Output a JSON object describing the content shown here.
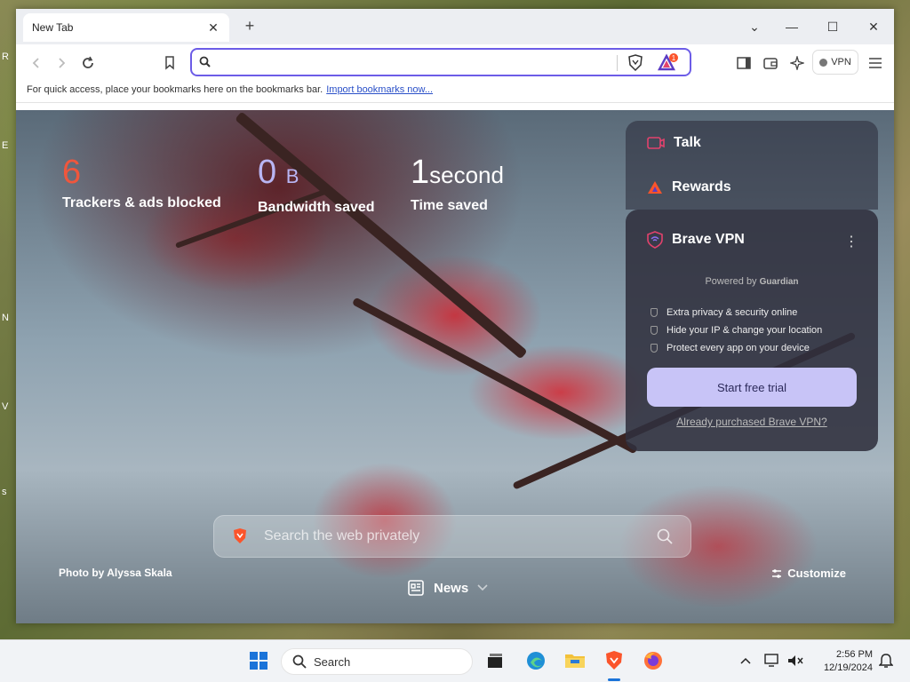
{
  "desktop": {
    "edge_letters": [
      "R",
      "E",
      "N",
      "V",
      "s"
    ]
  },
  "browser": {
    "tab": {
      "title": "New Tab",
      "close": "✕"
    },
    "new_tab": "+",
    "window": {
      "dropdown": "⌄",
      "minimize": "—",
      "maximize": "☐",
      "close": "✕"
    },
    "toolbar": {
      "vpn_label": "VPN",
      "rewards_badge": "1"
    },
    "bookmarks_bar": {
      "text": "For quick access, place your bookmarks here on the bookmarks bar.",
      "link": "Import bookmarks now..."
    }
  },
  "ntp": {
    "stats": [
      {
        "value": "6",
        "unit": "",
        "label": "Trackers & ads blocked",
        "color": "#f0563c"
      },
      {
        "value": "0",
        "unit": "B",
        "label": "Bandwidth saved",
        "color": "#b9b6f4"
      },
      {
        "value": "1",
        "unit": "second",
        "label": "Time saved",
        "color": "#ffffff"
      }
    ],
    "sidebar": {
      "talk": "Talk",
      "rewards": "Rewards"
    },
    "vpn_card": {
      "title": "Brave VPN",
      "powered_by": "Powered by",
      "partner": "Guardian",
      "features": [
        "Extra privacy & security online",
        "Hide your IP & change your location",
        "Protect every app on your device"
      ],
      "cta": "Start free trial",
      "already": "Already purchased Brave VPN?"
    },
    "search_placeholder": "Search the web privately",
    "photo_credit": "Photo by Alyssa Skala",
    "customize": "Customize",
    "news": "News"
  },
  "taskbar": {
    "search": "Search",
    "time": "2:56 PM",
    "date": "12/19/2024"
  },
  "colors": {
    "accent": "#6c5ce7",
    "brave_orange": "#fb542b"
  }
}
